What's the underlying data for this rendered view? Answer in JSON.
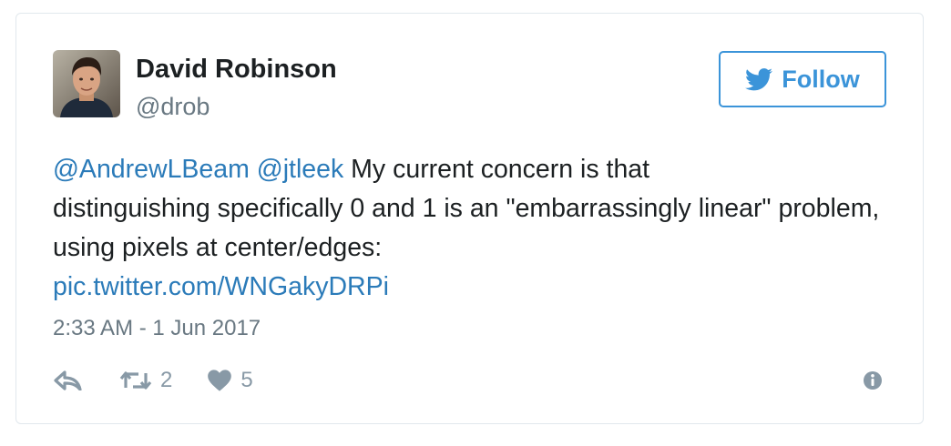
{
  "author": {
    "name": "David Robinson",
    "handle": "@drob",
    "avatar_icon": "user-avatar-photo"
  },
  "follow_button": {
    "label": "Follow",
    "icon": "twitter-bird-icon",
    "color": "#3b94d9"
  },
  "tweet": {
    "mention_1": "@AndrewLBeam",
    "mention_2": "@jtleek",
    "text_line_1": " My current concern is that",
    "text_rest": "distinguishing specifically 0 and 1 is an \"embarrassingly linear\" problem, using pixels at center/edges:",
    "link": "pic.twitter.com/WNGakyDRPi",
    "timestamp": "2:33 AM - 1 Jun 2017"
  },
  "actions": {
    "reply_icon": "reply-icon",
    "retweet_icon": "retweet-icon",
    "retweet_count": "2",
    "like_icon": "heart-icon",
    "like_count": "5",
    "info_icon": "info-icon"
  },
  "colors": {
    "link": "#2b7bb9",
    "text": "#1c2022",
    "muted": "#697882",
    "action": "#8899a6",
    "border": "#e1e8ed"
  }
}
